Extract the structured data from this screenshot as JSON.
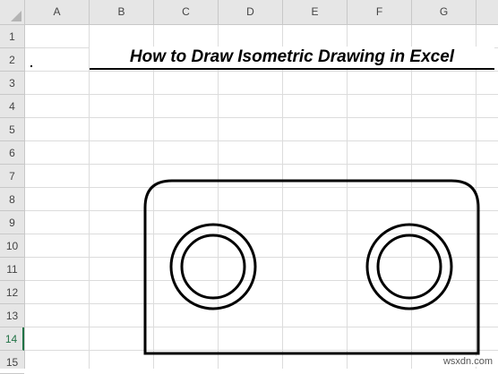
{
  "sheet": {
    "columns": [
      "A",
      "B",
      "C",
      "D",
      "E",
      "F",
      "G"
    ],
    "rows": [
      "1",
      "2",
      "3",
      "4",
      "5",
      "6",
      "7",
      "8",
      "9",
      "10",
      "11",
      "12",
      "13",
      "14",
      "15"
    ],
    "active_row": "14"
  },
  "title_text": "How to Draw Isometric Drawing in Excel",
  "watermark": "wsxdn.com",
  "colors": {
    "accent": "#217346",
    "gridline": "#dcdcdc",
    "header_bg": "#e6e6e6"
  }
}
